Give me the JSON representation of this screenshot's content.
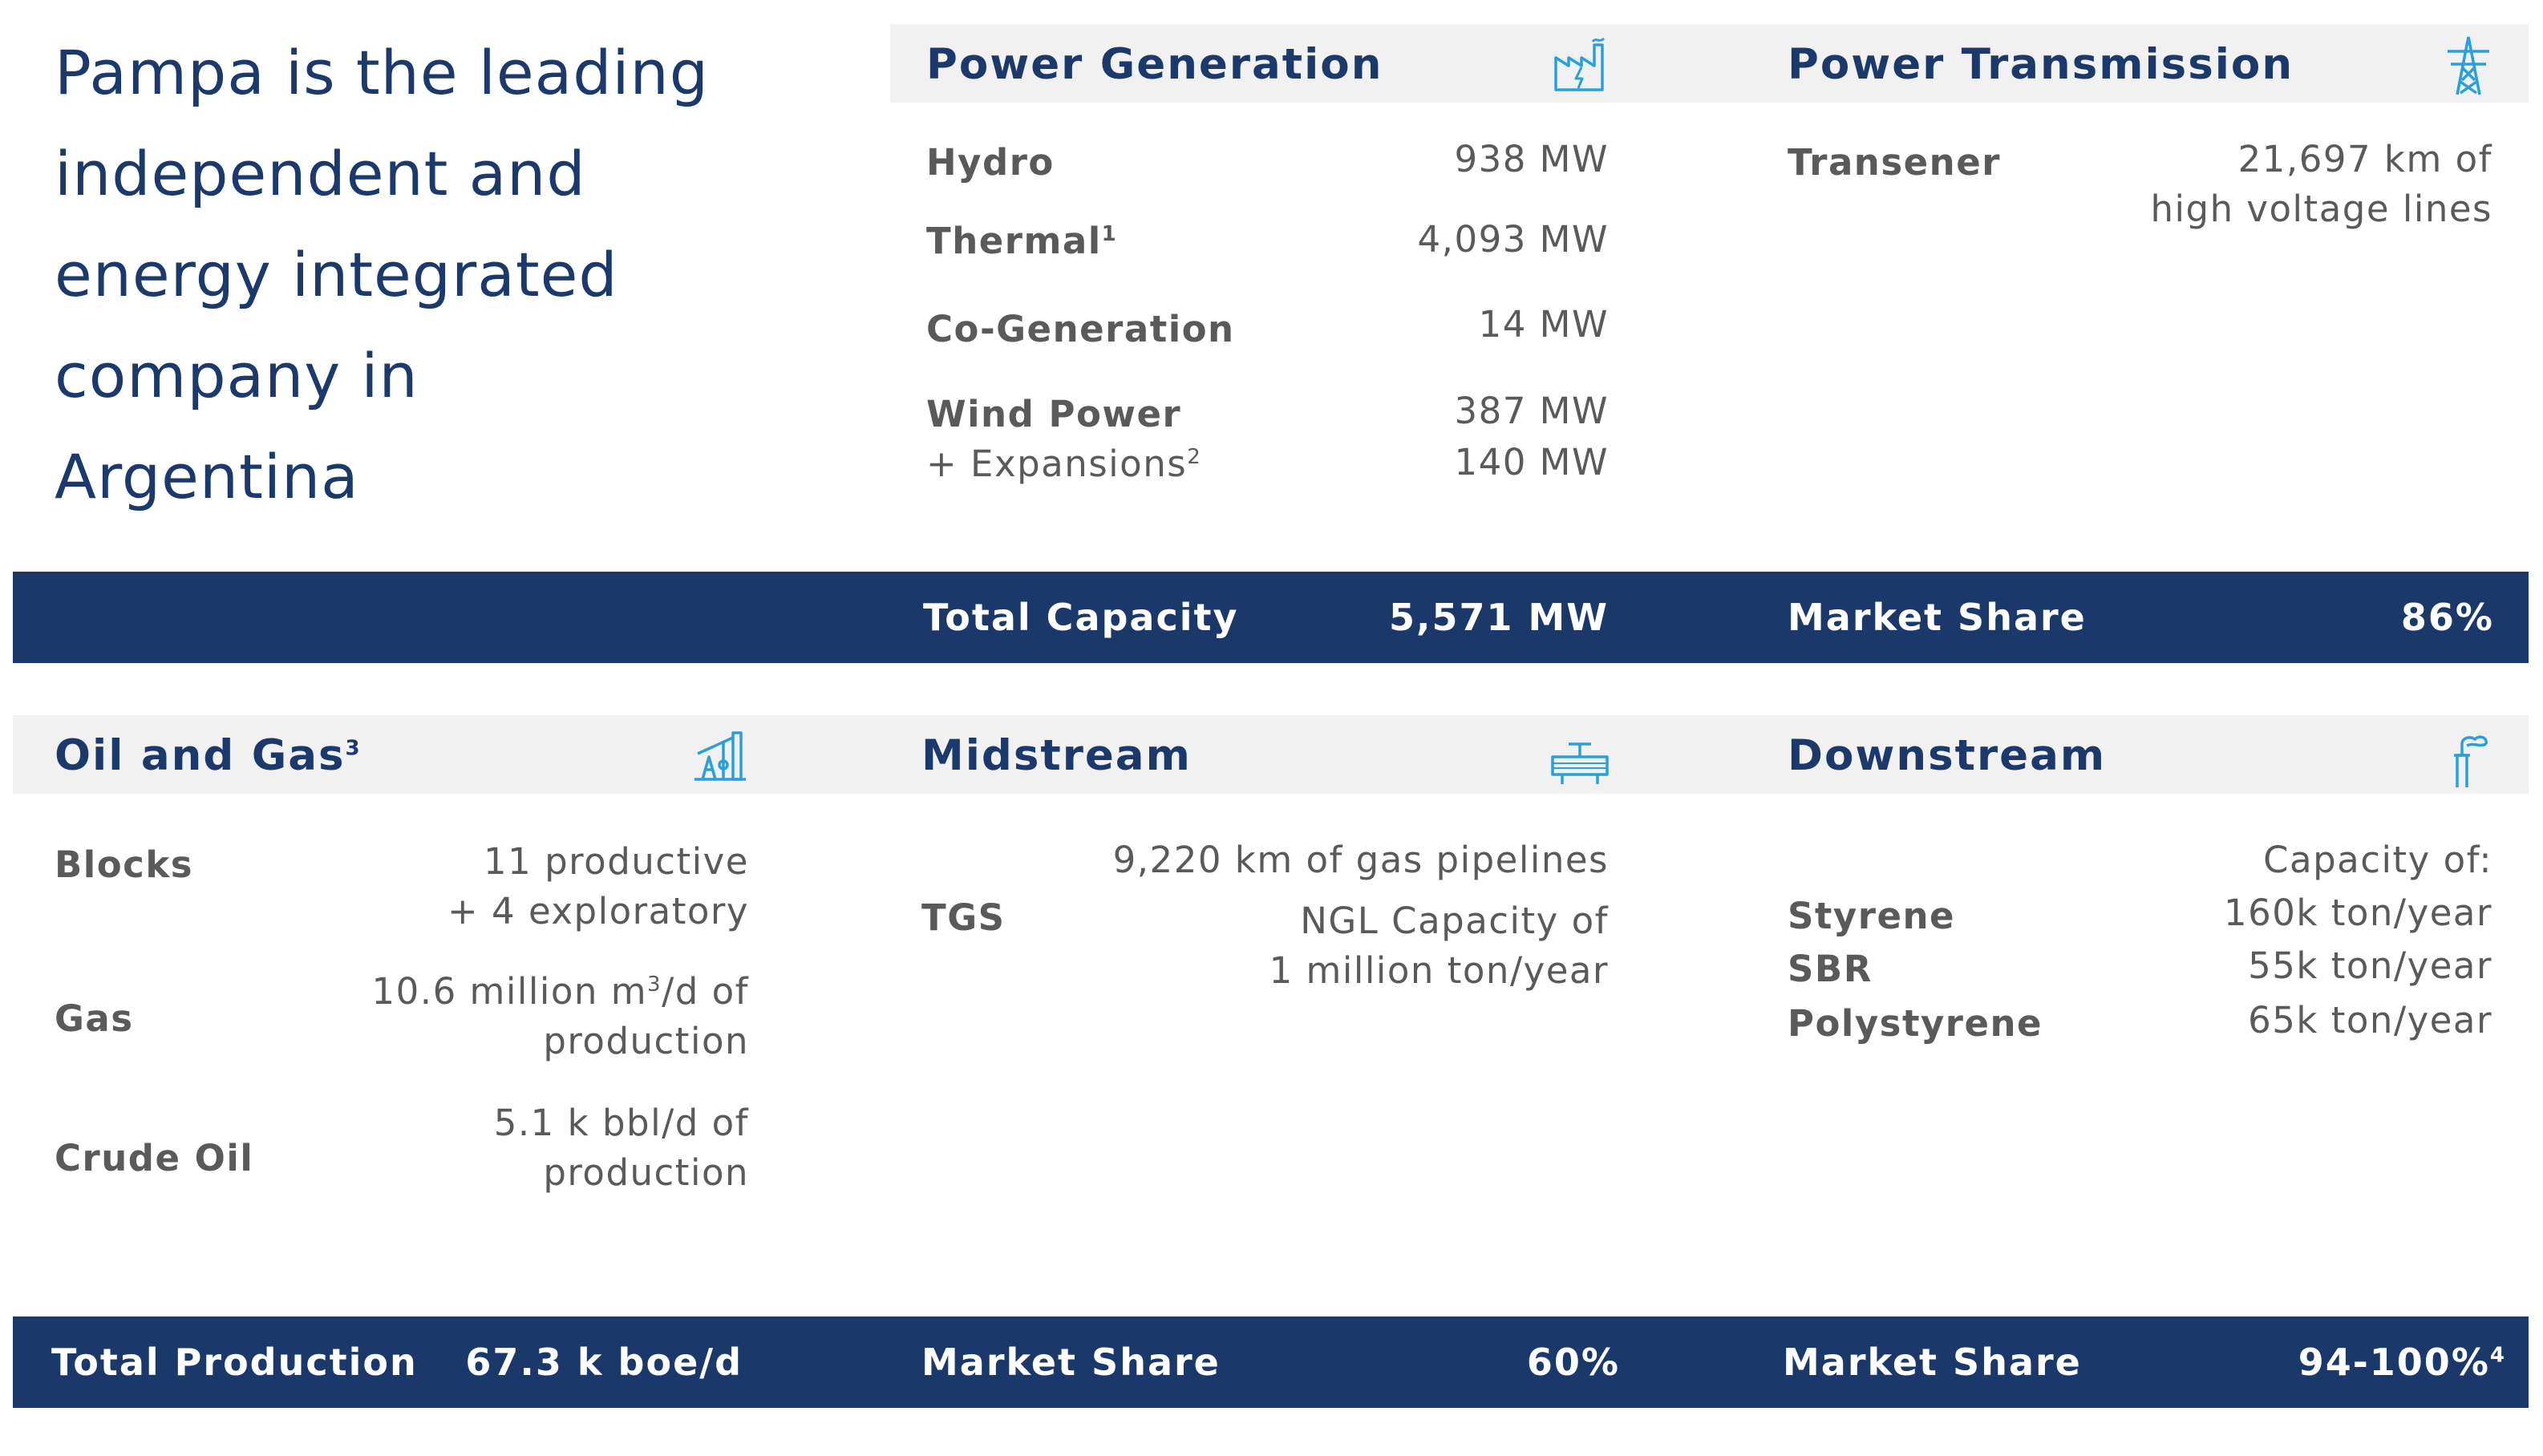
{
  "intro": {
    "lines": [
      "Pampa is the leading",
      "independent and",
      "energy integrated",
      "company in",
      "Argentina"
    ]
  },
  "power_generation": {
    "title": "Power Generation",
    "icon": "power-plant-icon",
    "rows": [
      {
        "label": "Hydro",
        "value": "938 MW"
      },
      {
        "label": "Thermal",
        "sup": "1",
        "value": "4,093 MW"
      },
      {
        "label": "Co-Generation",
        "value": "14 MW"
      },
      {
        "label": "Wind Power",
        "value": "387 MW"
      }
    ],
    "expansion": {
      "label": "+ Expansions",
      "sup": "2",
      "value": "140 MW"
    },
    "total_label": "Total Capacity",
    "total_value": "5,571 MW"
  },
  "power_transmission": {
    "title": "Power Transmission",
    "icon": "transmission-tower-icon",
    "label": "Transener",
    "value_line1": "21,697 km of",
    "value_line2": "high voltage lines",
    "market_label": "Market Share",
    "market_value": "86%"
  },
  "oil_gas": {
    "title": "Oil and Gas",
    "title_sup": "3",
    "icon": "oil-pump-icon",
    "blocks_label": "Blocks",
    "blocks_line1": "11 productive",
    "blocks_line2": "+ 4 exploratory",
    "gas_label": "Gas",
    "gas_line1_pre": "10.6 million m",
    "gas_line1_sup": "3",
    "gas_line1_post": "/d of",
    "gas_line2": "production",
    "crude_label": "Crude Oil",
    "crude_line1": "5.1 k bbl/d of",
    "crude_line2": "production",
    "total_label": "Total Production",
    "total_value": "67.3 k boe/d"
  },
  "midstream": {
    "title": "Midstream",
    "icon": "pipeline-valve-icon",
    "label": "TGS",
    "line1": "9,220 km of gas pipelines",
    "line2": "NGL Capacity of",
    "line3": "1 million ton/year",
    "market_label": "Market Share",
    "market_value": "60%"
  },
  "downstream": {
    "title": "Downstream",
    "icon": "refinery-flare-icon",
    "capacity_header": "Capacity of:",
    "rows": [
      {
        "label": "Styrene",
        "value": "160k ton/year"
      },
      {
        "label": "SBR",
        "value": "55k ton/year"
      },
      {
        "label": "Polystyrene",
        "value": "65k ton/year"
      }
    ],
    "market_label": "Market Share",
    "market_value": "94-100%",
    "market_sup": "4"
  },
  "colors": {
    "navy": "#1b386b",
    "icon_blue": "#2a9fd8",
    "header_bg": "#f1f1f1",
    "text_gray": "#5a5a5a"
  }
}
